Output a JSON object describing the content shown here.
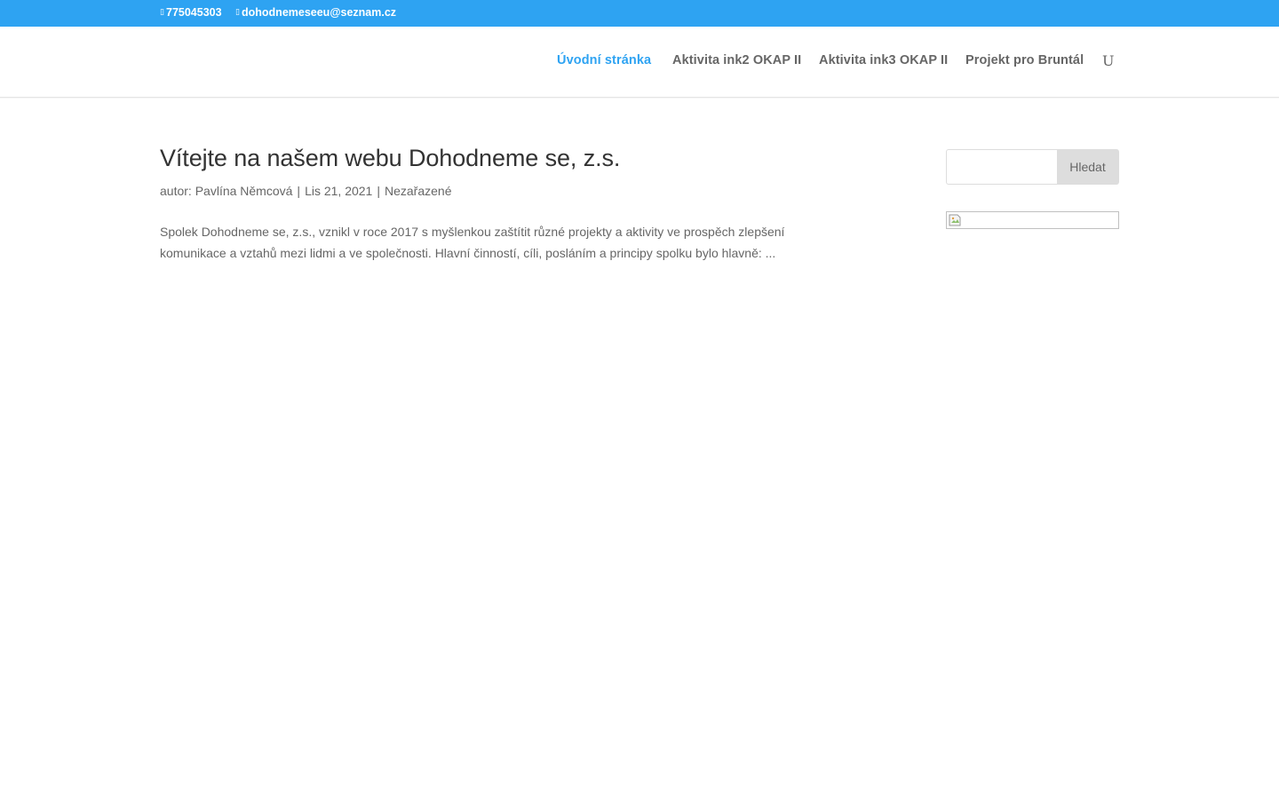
{
  "topbar": {
    "phone_icon": "phone-icon",
    "phone": "775045303",
    "email_icon": "mail-icon",
    "email": "dohodnemeseeu@seznam.cz"
  },
  "nav": {
    "items": [
      {
        "label": "Úvodní stránka",
        "active": true
      },
      {
        "label": "Aktivita ink2 OKAP II",
        "active": false
      },
      {
        "label": "Aktivita ink3 OKAP II",
        "active": false
      },
      {
        "label": "Projekt pro Bruntál",
        "active": false
      }
    ],
    "search_toggle_glyph": "U",
    "search_toggle_icon": "search-icon"
  },
  "post": {
    "title": "Vítejte na našem webu Dohodneme se, z.s.",
    "meta_prefix": "autor: ",
    "author": "Pavlína Němcová",
    "separator": "|",
    "date": "Lis 21, 2021",
    "category": "Nezařazené",
    "excerpt": "Spolek Dohodneme se, z.s., vznikl v roce 2017 s myšlenkou zaštítit různé projekty a aktivity ve prospěch zlepšení komunikace a vztahů  mezi lidmi a ve společnosti. Hlavní činností, cíli, posláním  a principy spolku bylo hlavně: ..."
  },
  "sidebar": {
    "search_value": "",
    "search_button": "Hledat",
    "image_icon": "broken-image-icon"
  },
  "colors": {
    "accent": "#2ea3f2",
    "text": "#666666",
    "heading": "#333333"
  }
}
